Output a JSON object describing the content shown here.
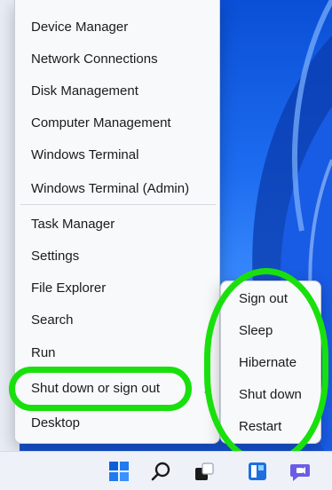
{
  "menu": {
    "items": [
      {
        "label": "Device Manager",
        "name": "menu-item-device-manager"
      },
      {
        "label": "Network Connections",
        "name": "menu-item-network-connections"
      },
      {
        "label": "Disk Management",
        "name": "menu-item-disk-management"
      },
      {
        "label": "Computer Management",
        "name": "menu-item-computer-management"
      },
      {
        "label": "Windows Terminal",
        "name": "menu-item-windows-terminal"
      },
      {
        "label": "Windows Terminal (Admin)",
        "name": "menu-item-windows-terminal-admin"
      },
      {
        "label": "Task Manager",
        "name": "menu-item-task-manager"
      },
      {
        "label": "Settings",
        "name": "menu-item-settings"
      },
      {
        "label": "File Explorer",
        "name": "menu-item-file-explorer"
      },
      {
        "label": "Search",
        "name": "menu-item-search"
      },
      {
        "label": "Run",
        "name": "menu-item-run"
      },
      {
        "label": "Shut down or sign out",
        "name": "menu-item-shut-down-or-sign-out"
      },
      {
        "label": "Desktop",
        "name": "menu-item-desktop"
      }
    ]
  },
  "submenu": {
    "items": [
      {
        "label": "Sign out",
        "name": "submenu-item-sign-out"
      },
      {
        "label": "Sleep",
        "name": "submenu-item-sleep"
      },
      {
        "label": "Hibernate",
        "name": "submenu-item-hibernate"
      },
      {
        "label": "Shut down",
        "name": "submenu-item-shut-down"
      },
      {
        "label": "Restart",
        "name": "submenu-item-restart"
      }
    ]
  },
  "taskbar": {
    "icons": [
      "windows-start-icon",
      "search-icon",
      "task-view-icon",
      "widgets-icon",
      "chat-icon"
    ]
  },
  "colors": {
    "annotation": "#19e00d",
    "accent": "#0a5fd6"
  }
}
